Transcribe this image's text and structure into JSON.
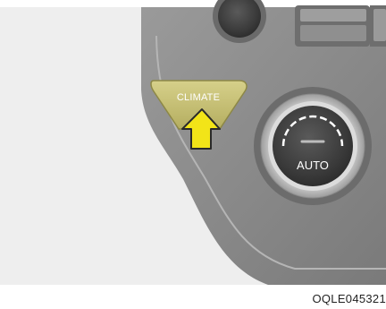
{
  "panel": {
    "climate_button_label": "CLIMATE",
    "dial_label": "AUTO"
  },
  "figure_code": "OQLE045321",
  "colors": {
    "background": "#eeeeee",
    "panel": "#8c8c8c",
    "highlight": "#c8c27a",
    "arrow": "#f2e418"
  },
  "icons": [
    "up-arrow-icon",
    "temperature-dial-icon"
  ]
}
